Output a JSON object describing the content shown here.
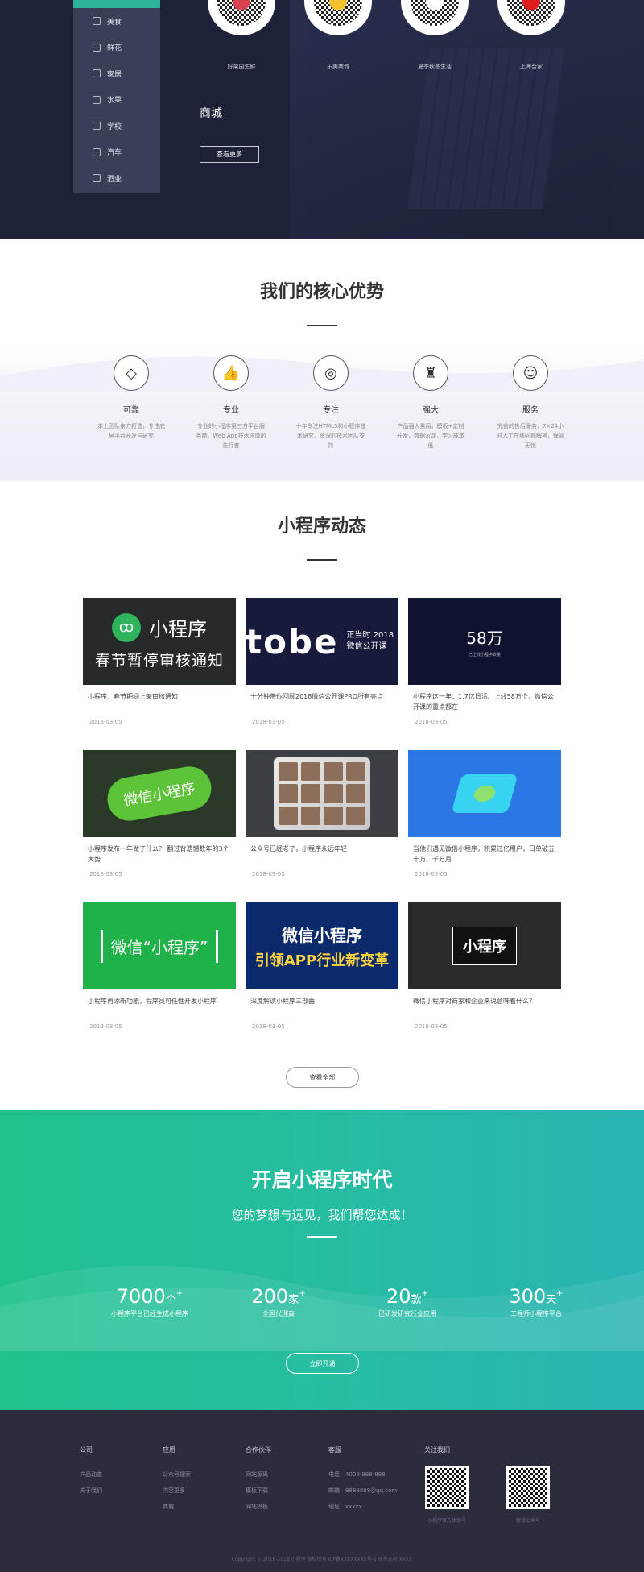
{
  "hero": {
    "menu": [
      {
        "label": "美食",
        "icon": "food-icon"
      },
      {
        "label": "鲜花",
        "icon": "flower-icon"
      },
      {
        "label": "家居",
        "icon": "home-icon"
      },
      {
        "label": "水果",
        "icon": "fruit-icon"
      },
      {
        "label": "学校",
        "icon": "school-icon"
      },
      {
        "label": "汽车",
        "icon": "car-icon"
      },
      {
        "label": "酒业",
        "icon": "wine-icon"
      }
    ],
    "qrcodes": [
      {
        "label": "好果园生鲜",
        "badge_color": "#d9434f"
      },
      {
        "label": "乐美商城",
        "badge_color": "#f2c230"
      },
      {
        "label": "夏季秋冬生活",
        "badge_color": "#ffffff"
      },
      {
        "label": "上海合家",
        "badge_color": "#e01b1b"
      }
    ],
    "title": "商城",
    "button": "查看更多"
  },
  "advantages": {
    "title": "我们的核心优势",
    "items": [
      {
        "name": "可靠",
        "icon": "diamond-icon",
        "glyph": "◇",
        "desc": "本土团队亲力打造，专注底层平台开发与研究"
      },
      {
        "name": "专业",
        "icon": "thumbs-up-icon",
        "glyph": "👍",
        "desc": "专业的小程序第三方平台服务商，Web App技术领域的先行者"
      },
      {
        "name": "专注",
        "icon": "target-icon",
        "glyph": "◎",
        "desc": "十年专注HTML5和小程序技术研究，资深的技术团队支持"
      },
      {
        "name": "强大",
        "icon": "trophy-icon",
        "glyph": "♜",
        "desc": "产品强大易用，模板+定制开发，数据沉淀，学习成本低"
      },
      {
        "name": "服务",
        "icon": "support-icon",
        "glyph": "☺",
        "desc": "完善的售后服务，7×24小时人工在线问题解答，保驾无忧"
      }
    ]
  },
  "news": {
    "title": "小程序动态",
    "more_button": "查看全部",
    "items": [
      {
        "title": "小程序：春节期间上架审核通知",
        "date": "2018-03-05",
        "img_line1": "小程序",
        "img_line2": "春节暂停审核通知"
      },
      {
        "title": "十分钟带你回顾2018微信公开课PRO所有亮点",
        "date": "2018-03-05",
        "img_line1": "tobe",
        "img_line2": "正当时 2018 微信公开课"
      },
      {
        "title": "小程序这一年：1.7亿日活、上线58万个，微信公开课的重点都在",
        "date": "2018-03-05",
        "img_line1": "58万",
        "img_line2": "已上线小程序数量"
      },
      {
        "title": "小程序发布一年做了什么？ 翻过背遗憾数年的3个大势",
        "date": "2018-03-05",
        "img_line1": "微信小程序",
        "img_line2": ""
      },
      {
        "title": "公众号已经老了，小程序永远年轻",
        "date": "2018-03-05",
        "img_line1": "",
        "img_line2": ""
      },
      {
        "title": "当他们遇见微信小程序，积累过亿用户，日单破五十万、千万月",
        "date": "2018-03-05",
        "img_line1": "",
        "img_line2": ""
      },
      {
        "title": "小程序再添新功能，程序员可任性开发小程序",
        "date": "2018-03-05",
        "img_line1": "微信“小程序”",
        "img_line2": ""
      },
      {
        "title": "深度解读小程序三部曲",
        "date": "2018-03-05",
        "img_line1": "微信小程序",
        "img_line2": "引领APP行业新变革"
      },
      {
        "title": "微信小程序对商家和企业来说意味着什么？",
        "date": "2018-03-05",
        "img_line1": "小程序",
        "img_line2": ""
      }
    ]
  },
  "cta": {
    "title": "开启小程序时代",
    "subtitle": "您的梦想与远见，我们帮您达成！",
    "stats": [
      {
        "num": "7000",
        "unit": "个",
        "label": "小程序平台已经生成小程序"
      },
      {
        "num": "200",
        "unit": "家",
        "label": "全国代理商"
      },
      {
        "num": "20",
        "unit": "款",
        "label": "已研发研究行业应用"
      },
      {
        "num": "300",
        "unit": "天",
        "label": "工程师小程序平台"
      }
    ],
    "button": "立即开通"
  },
  "footer": {
    "columns": [
      {
        "title": "公司",
        "links": [
          "产品动态",
          "关于我们"
        ]
      },
      {
        "title": "应用",
        "links": [
          "公众号搜索",
          "内容更多",
          "商城"
        ]
      },
      {
        "title": "合作伙伴",
        "links": [
          "网站源码",
          "模板下载",
          "网站模板"
        ]
      },
      {
        "title": "客服",
        "links": [
          "电话：4008-888-888",
          "邮箱：8888888@qq.com",
          "地址：xxxxx"
        ]
      }
    ],
    "follow_title": "关注我们",
    "qr_labels": [
      "小程序官方体验号",
      "微信公众号"
    ],
    "copyright": "Copyright © 2016-2018 小程序 版权所有 ICP备XXXXXXXX号-1 技术支持 XXXX"
  },
  "colors": {
    "hero_bg": "#1d2239",
    "accent_green": "#2fb29a",
    "cta_gradient_start": "#20c28e",
    "cta_gradient_end": "#2ab4b4",
    "footer_bg": "#2b2d3d"
  }
}
